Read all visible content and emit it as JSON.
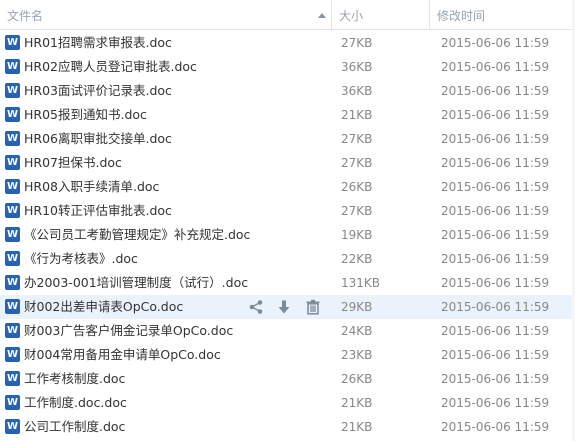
{
  "header": {
    "name_label": "文件名",
    "size_label": "大小",
    "time_label": "修改时间"
  },
  "icon_label": "W",
  "files": [
    {
      "name": "HR01招聘需求审报表.doc",
      "size": "27KB",
      "time": "2015-06-06 11:59"
    },
    {
      "name": "HR02应聘人员登记审批表.doc",
      "size": "36KB",
      "time": "2015-06-06 11:59"
    },
    {
      "name": "HR03面试评价记录表.doc",
      "size": "36KB",
      "time": "2015-06-06 11:59"
    },
    {
      "name": "HR05报到通知书.doc",
      "size": "21KB",
      "time": "2015-06-06 11:59"
    },
    {
      "name": "HR06离职审批交接单.doc",
      "size": "27KB",
      "time": "2015-06-06 11:59"
    },
    {
      "name": "HR07担保书.doc",
      "size": "27KB",
      "time": "2015-06-06 11:59"
    },
    {
      "name": "HR08入职手续清单.doc",
      "size": "26KB",
      "time": "2015-06-06 11:59"
    },
    {
      "name": "HR10转正评估审批表.doc",
      "size": "27KB",
      "time": "2015-06-06 11:59"
    },
    {
      "name": "《公司员工考勤管理规定》补充规定.doc",
      "size": "19KB",
      "time": "2015-06-06 11:59"
    },
    {
      "name": "《行为考核表》.doc",
      "size": "22KB",
      "time": "2015-06-06 11:59"
    },
    {
      "name": "办2003-001培训管理制度（试行）.doc",
      "size": "131KB",
      "time": "2015-06-06 11:59"
    },
    {
      "name": "财002出差申请表OpCo.doc",
      "size": "29KB",
      "time": "2015-06-06 11:59"
    },
    {
      "name": "财003广告客户佣金记录单OpCo.doc",
      "size": "24KB",
      "time": "2015-06-06 11:59"
    },
    {
      "name": "财004常用备用金申请单OpCo.doc",
      "size": "23KB",
      "time": "2015-06-06 11:59"
    },
    {
      "name": "工作考核制度.doc",
      "size": "26KB",
      "time": "2015-06-06 11:59"
    },
    {
      "name": "工作制度.doc.doc",
      "size": "21KB",
      "time": "2015-06-06 11:59"
    },
    {
      "name": "公司工作制度.doc",
      "size": "21KB",
      "time": "2015-06-06 11:59"
    }
  ],
  "hovered_row_index": 11,
  "colors": {
    "doc_icon": "#2a62b3",
    "hover_row": "#eaf3fb",
    "action_icon": "#7d8a97"
  },
  "row_actions": [
    "share-icon",
    "download-icon",
    "delete-icon"
  ]
}
